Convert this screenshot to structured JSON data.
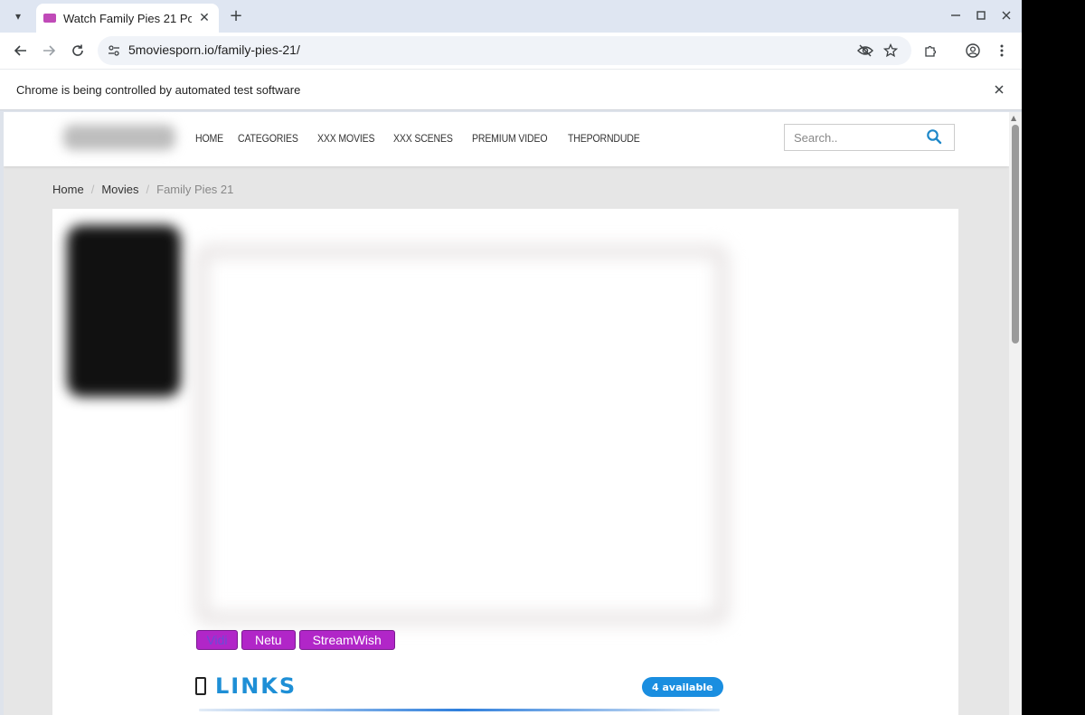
{
  "browser": {
    "tab_title": "Watch Family Pies 21 Por",
    "url": "5moviesporn.io/family-pies-21/",
    "infobar_text": "Chrome is being controlled by automated test software"
  },
  "site": {
    "nav": [
      "HOME",
      "CATEGORIES",
      "XXX MOVIES",
      "XXX SCENES",
      "PREMIUM VIDEO",
      "THEPORNDUDE"
    ],
    "search_placeholder": "Search..",
    "breadcrumb": {
      "home": "Home",
      "movies": "Movies",
      "current": "Family Pies 21",
      "separator": "/"
    },
    "servers": [
      "Vidi",
      "Netu",
      "StreamWish"
    ],
    "links_title": "LINKS",
    "available_badge": "4 available"
  },
  "colors": {
    "server_button": "#b126c8",
    "links_title": "#1e8fd6",
    "badge": "#1a8ee0",
    "search_icon": "#1e88c9"
  }
}
